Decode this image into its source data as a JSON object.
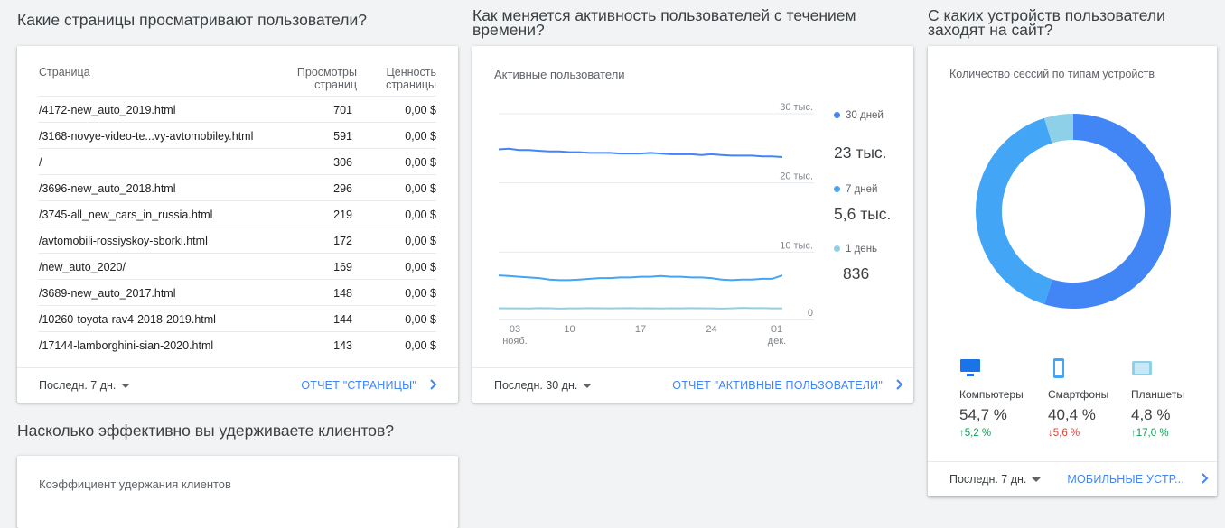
{
  "sections": {
    "pages_title": "Какие страницы просматривают пользователи?",
    "activity_title": "Как меняется активность пользователей с течением времени?",
    "devices_title": "С каких устройств пользователи заходят на сайт?",
    "retention_title": "Насколько эффективно вы удерживаете клиентов?"
  },
  "pages_card": {
    "col_page": "Страница",
    "col_views": "Просмотры страниц",
    "col_value": "Ценность страницы",
    "rows": [
      {
        "page": "/4172-new_auto_2019.html",
        "views": "701",
        "value": "0,00 $"
      },
      {
        "page": "/3168-novye-video-te...vy-avtomobiley.html",
        "views": "591",
        "value": "0,00 $"
      },
      {
        "page": "/",
        "views": "306",
        "value": "0,00 $"
      },
      {
        "page": "/3696-new_auto_2018.html",
        "views": "296",
        "value": "0,00 $"
      },
      {
        "page": "/3745-all_new_cars_in_russia.html",
        "views": "219",
        "value": "0,00 $"
      },
      {
        "page": "/avtomobili-rossiyskoy-sborki.html",
        "views": "172",
        "value": "0,00 $"
      },
      {
        "page": "/new_auto_2020/",
        "views": "169",
        "value": "0,00 $"
      },
      {
        "page": "/3689-new_auto_2017.html",
        "views": "148",
        "value": "0,00 $"
      },
      {
        "page": "/10260-toyota-rav4-2018-2019.html",
        "views": "144",
        "value": "0,00 $"
      },
      {
        "page": "/17144-lamborghini-sian-2020.html",
        "views": "143",
        "value": "0,00 $"
      }
    ],
    "period": "Последн. 7 дн.",
    "report_link": "ОТЧЕТ \"СТРАНИЦЫ\""
  },
  "activity_card": {
    "subtitle": "Активные пользователи",
    "y_ticks": [
      "30 тыс.",
      "20 тыс.",
      "10 тыс.",
      "0"
    ],
    "x_ticks": [
      {
        "day": "03",
        "month": "нояб."
      },
      {
        "day": "10",
        "month": ""
      },
      {
        "day": "17",
        "month": ""
      },
      {
        "day": "24",
        "month": ""
      },
      {
        "day": "01",
        "month": "дек."
      }
    ],
    "legend": [
      {
        "label": "30 дней",
        "value": "23 тыс.",
        "color": "#4285f4"
      },
      {
        "label": "7 дней",
        "value": "5,6 тыс.",
        "color": "#42a5f5"
      },
      {
        "label": "1 день",
        "value": "836",
        "color": "#8ed0e8"
      }
    ],
    "period": "Последн. 30 дн.",
    "report_link": "ОТЧЕТ \"АКТИВНЫЕ ПОЛЬЗОВАТЕЛИ\""
  },
  "chart_data": {
    "type": "line",
    "title": "Активные пользователи",
    "ylim": [
      0,
      30000
    ],
    "x": [
      "03 нояб.",
      "",
      "",
      "",
      "",
      "",
      "",
      "10",
      "",
      "",
      "",
      "",
      "",
      "",
      "17",
      "",
      "",
      "",
      "",
      "",
      "",
      "24",
      "",
      "",
      "",
      "",
      "",
      "",
      "01 дек."
    ],
    "series": [
      {
        "name": "30 дней",
        "values": [
          23800,
          23900,
          23700,
          23700,
          23600,
          23500,
          23500,
          23400,
          23400,
          23300,
          23300,
          23300,
          23200,
          23200,
          23200,
          23300,
          23200,
          23100,
          23100,
          23100,
          23000,
          23100,
          23000,
          22900,
          22900,
          22900,
          22800,
          22800,
          22700
        ]
      },
      {
        "name": "7 дней",
        "values": [
          5600,
          5500,
          5400,
          5300,
          5200,
          5000,
          4900,
          4900,
          5000,
          5100,
          5200,
          5200,
          5300,
          5300,
          5400,
          5400,
          5500,
          5400,
          5400,
          5300,
          5300,
          5200,
          5000,
          4900,
          5000,
          5000,
          5100,
          5100,
          5600
        ]
      },
      {
        "name": "1 день",
        "values": [
          850,
          830,
          840,
          820,
          860,
          850,
          800,
          830,
          840,
          860,
          850,
          830,
          850,
          860,
          840,
          850,
          820,
          850,
          840,
          860,
          850,
          830,
          800,
          840,
          900,
          860,
          860,
          830,
          836
        ]
      }
    ]
  },
  "devices_card": {
    "subtitle": "Количество сессий по типам устройств",
    "items": [
      {
        "name": "Компьютеры",
        "pct": "54,7 %",
        "delta": "5,2 %",
        "dir": "up",
        "color": "#4285f4",
        "share": 54.7
      },
      {
        "name": "Смартфоны",
        "pct": "40,4 %",
        "delta": "5,6 %",
        "dir": "down",
        "color": "#42a5f5",
        "share": 40.4
      },
      {
        "name": "Планшеты",
        "pct": "4,8 %",
        "delta": "17,0 %",
        "dir": "up",
        "color": "#8ed0e8",
        "share": 4.8
      }
    ],
    "period": "Последн. 7 дн.",
    "report_link": "МОБИЛЬНЫЕ УСТР..."
  },
  "retention_card": {
    "subtitle": "Коэффициент удержания клиентов"
  },
  "colors": {
    "link": "#4285f4",
    "up": "#0f9d58",
    "down": "#db4437"
  }
}
